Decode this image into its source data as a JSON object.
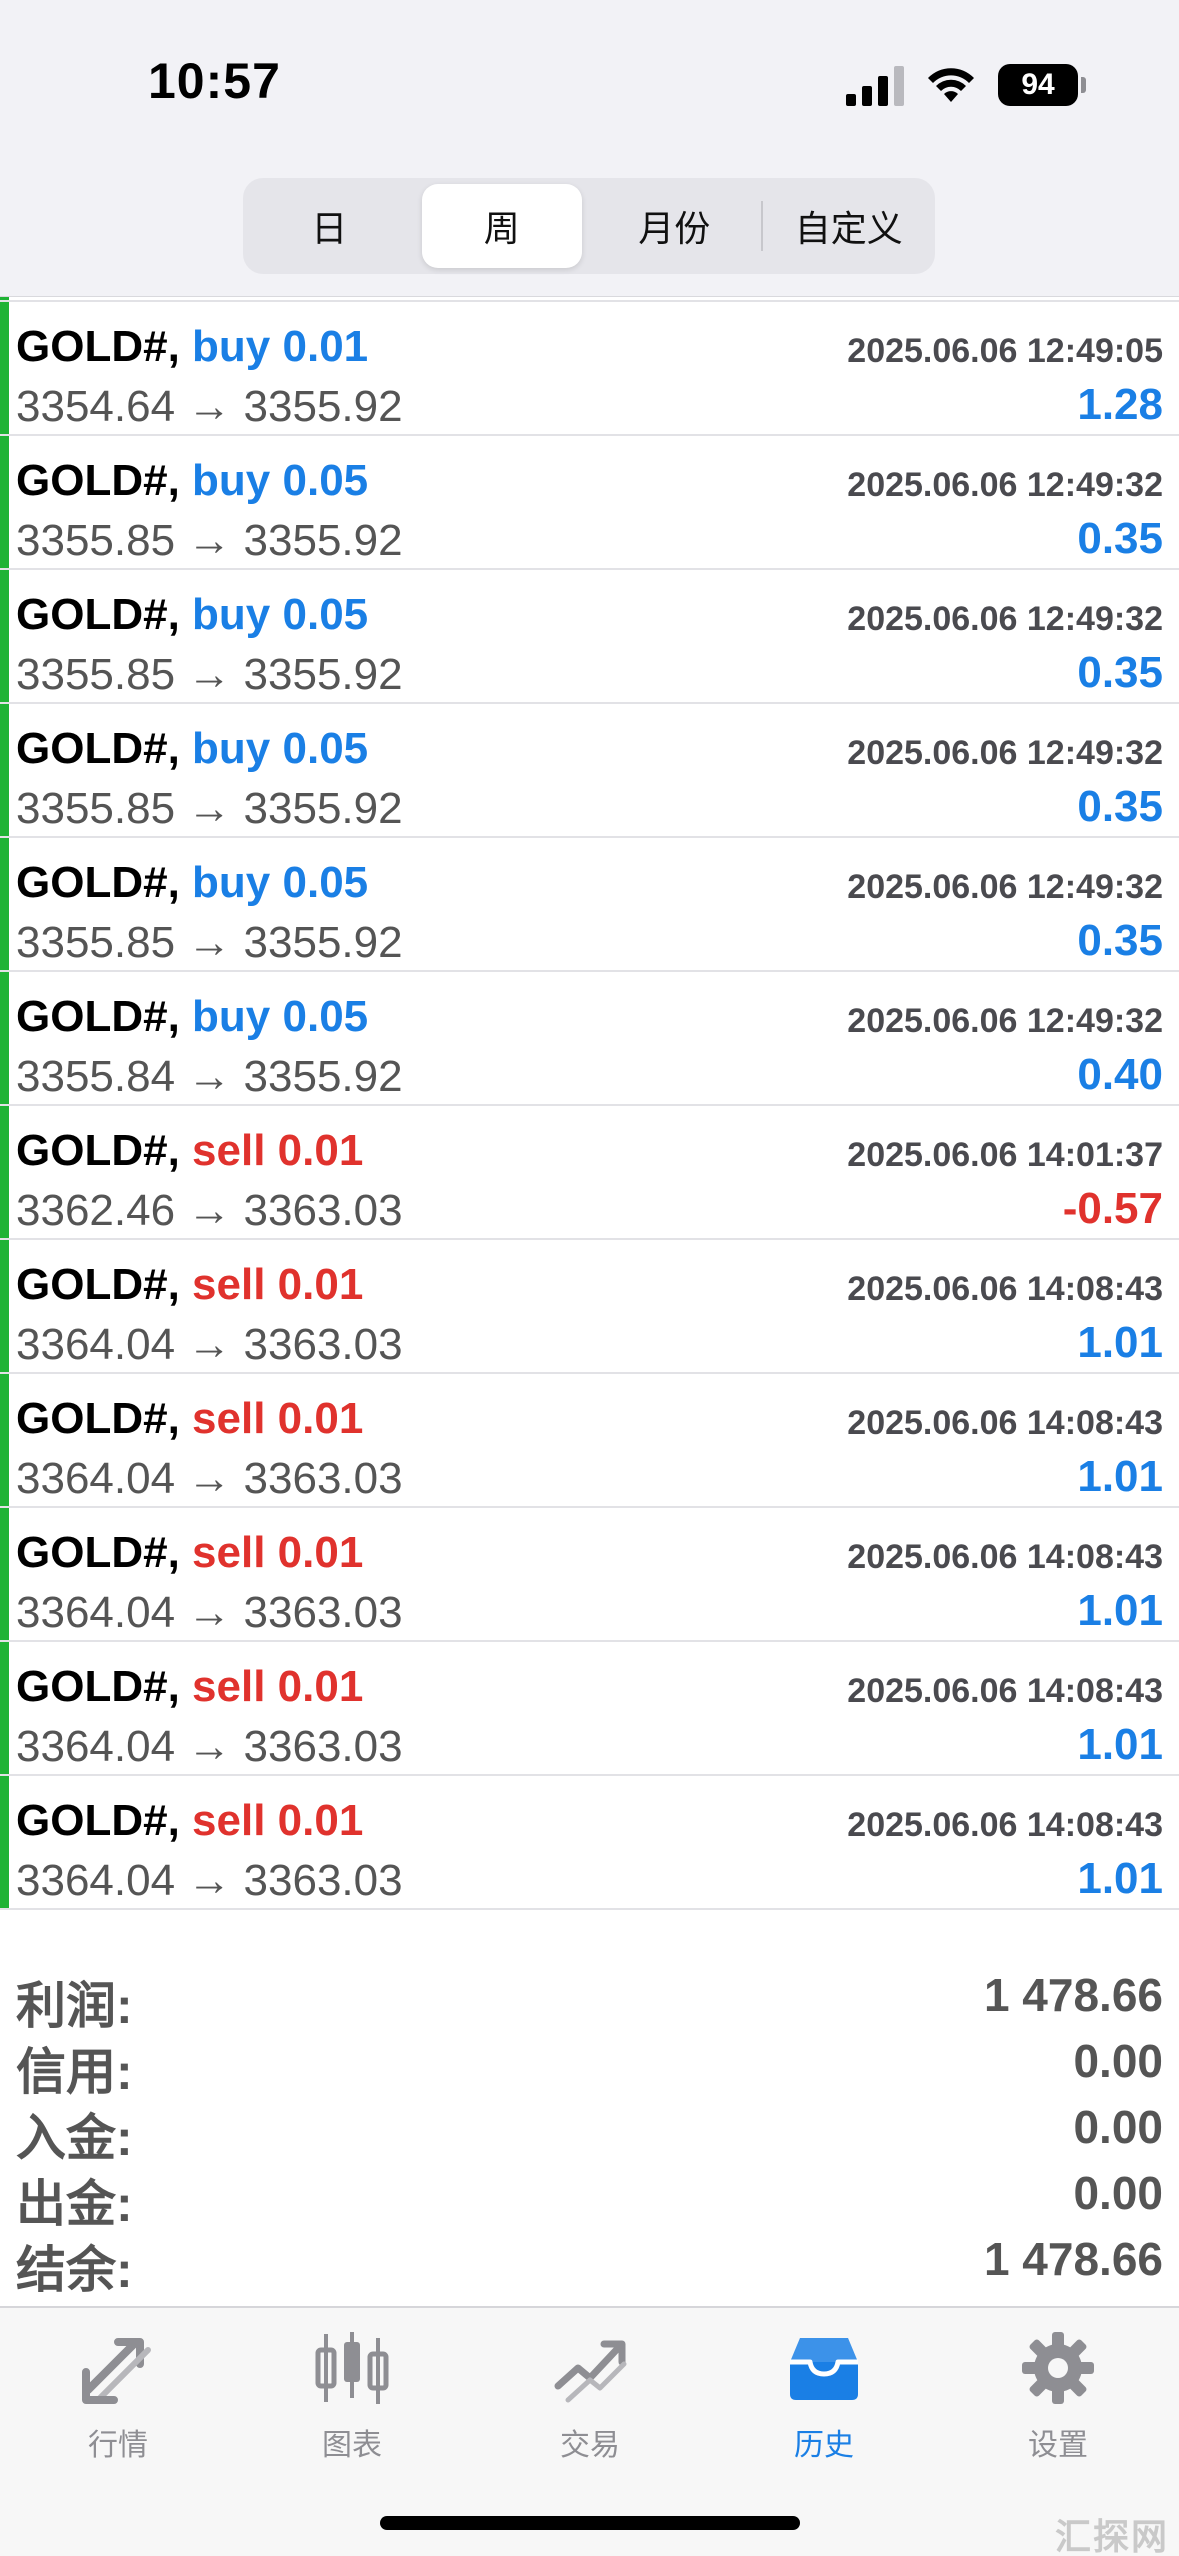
{
  "status_bar": {
    "time": "10:57",
    "battery": "94"
  },
  "segments": [
    {
      "label": "日",
      "active": false
    },
    {
      "label": "周",
      "active": true
    },
    {
      "label": "月份",
      "active": false
    },
    {
      "label": "自定义",
      "active": false
    }
  ],
  "trades": [
    {
      "symbol": "GOLD#,",
      "side": "buy",
      "volume": "0.01",
      "time": "2025.06.06 12:49:05",
      "open": "3354.64",
      "arrow": "→",
      "close": "3355.92",
      "profit": "1.28",
      "positive": true
    },
    {
      "symbol": "GOLD#,",
      "side": "buy",
      "volume": "0.05",
      "time": "2025.06.06 12:49:32",
      "open": "3355.85",
      "arrow": "→",
      "close": "3355.92",
      "profit": "0.35",
      "positive": true
    },
    {
      "symbol": "GOLD#,",
      "side": "buy",
      "volume": "0.05",
      "time": "2025.06.06 12:49:32",
      "open": "3355.85",
      "arrow": "→",
      "close": "3355.92",
      "profit": "0.35",
      "positive": true
    },
    {
      "symbol": "GOLD#,",
      "side": "buy",
      "volume": "0.05",
      "time": "2025.06.06 12:49:32",
      "open": "3355.85",
      "arrow": "→",
      "close": "3355.92",
      "profit": "0.35",
      "positive": true
    },
    {
      "symbol": "GOLD#,",
      "side": "buy",
      "volume": "0.05",
      "time": "2025.06.06 12:49:32",
      "open": "3355.85",
      "arrow": "→",
      "close": "3355.92",
      "profit": "0.35",
      "positive": true
    },
    {
      "symbol": "GOLD#,",
      "side": "buy",
      "volume": "0.05",
      "time": "2025.06.06 12:49:32",
      "open": "3355.84",
      "arrow": "→",
      "close": "3355.92",
      "profit": "0.40",
      "positive": true
    },
    {
      "symbol": "GOLD#,",
      "side": "sell",
      "volume": "0.01",
      "time": "2025.06.06 14:01:37",
      "open": "3362.46",
      "arrow": "→",
      "close": "3363.03",
      "profit": "-0.57",
      "positive": false
    },
    {
      "symbol": "GOLD#,",
      "side": "sell",
      "volume": "0.01",
      "time": "2025.06.06 14:08:43",
      "open": "3364.04",
      "arrow": "→",
      "close": "3363.03",
      "profit": "1.01",
      "positive": true
    },
    {
      "symbol": "GOLD#,",
      "side": "sell",
      "volume": "0.01",
      "time": "2025.06.06 14:08:43",
      "open": "3364.04",
      "arrow": "→",
      "close": "3363.03",
      "profit": "1.01",
      "positive": true
    },
    {
      "symbol": "GOLD#,",
      "side": "sell",
      "volume": "0.01",
      "time": "2025.06.06 14:08:43",
      "open": "3364.04",
      "arrow": "→",
      "close": "3363.03",
      "profit": "1.01",
      "positive": true
    },
    {
      "symbol": "GOLD#,",
      "side": "sell",
      "volume": "0.01",
      "time": "2025.06.06 14:08:43",
      "open": "3364.04",
      "arrow": "→",
      "close": "3363.03",
      "profit": "1.01",
      "positive": true
    },
    {
      "symbol": "GOLD#,",
      "side": "sell",
      "volume": "0.01",
      "time": "2025.06.06 14:08:43",
      "open": "3364.04",
      "arrow": "→",
      "close": "3363.03",
      "profit": "1.01",
      "positive": true
    }
  ],
  "summary": [
    {
      "label": "利润:",
      "value": "1 478.66"
    },
    {
      "label": "信用:",
      "value": "0.00"
    },
    {
      "label": "入金:",
      "value": "0.00"
    },
    {
      "label": "出金:",
      "value": "0.00"
    },
    {
      "label": "结余:",
      "value": "1 478.66"
    }
  ],
  "tabs": [
    {
      "label": "行情",
      "icon": "quotes-icon",
      "active": false
    },
    {
      "label": "图表",
      "icon": "chart-icon",
      "active": false
    },
    {
      "label": "交易",
      "icon": "trade-icon",
      "active": false
    },
    {
      "label": "历史",
      "icon": "history-icon",
      "active": true
    },
    {
      "label": "设置",
      "icon": "settings-icon",
      "active": false
    }
  ],
  "watermark": "汇探网",
  "colors": {
    "buy": "#1a7fe5",
    "sell": "#e0322d",
    "accent": "#1a7fe5",
    "bar": "#1fb335"
  }
}
